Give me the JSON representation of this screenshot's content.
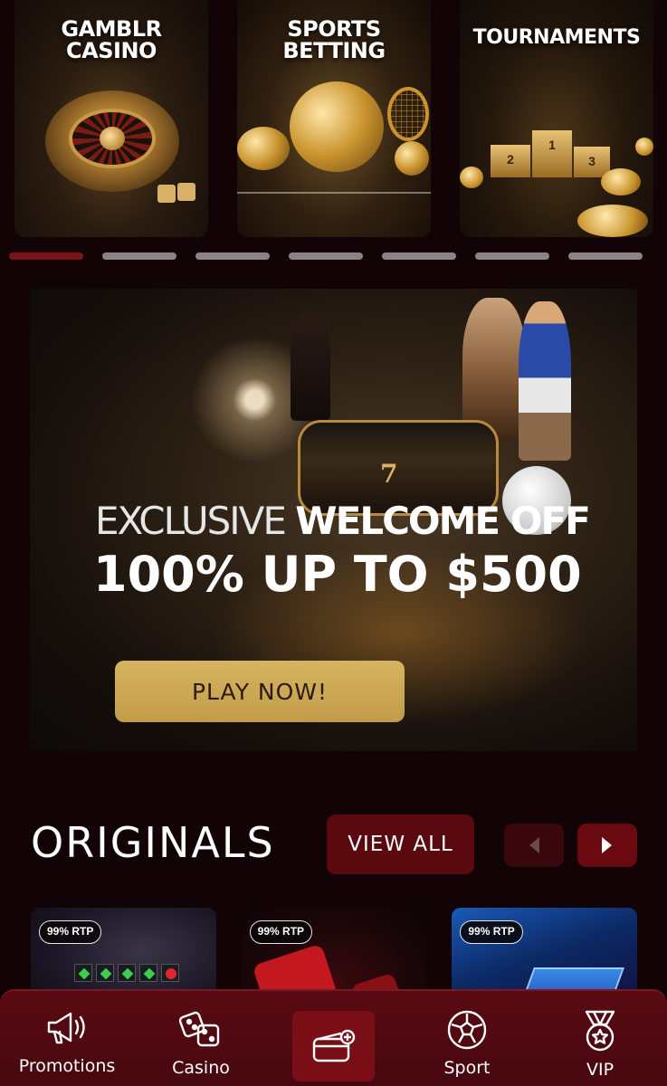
{
  "categories": [
    {
      "title": "GAMBLR\nCASINO"
    },
    {
      "title": "SPORTS\nBETTING"
    },
    {
      "title": "TOURNAMENTS"
    }
  ],
  "slider": {
    "count": 7,
    "active": 0
  },
  "hero": {
    "line1_thin": "EXCLUSIVE ",
    "line1_bold": "WELCOME OFF",
    "line2": "100% UP TO $500",
    "cta": "PLAY NOW!",
    "slot_symbols": [
      "7"
    ]
  },
  "originals": {
    "title": "ORIGINALS",
    "view_all": "VIEW ALL",
    "games": [
      {
        "badge": "99% RTP"
      },
      {
        "badge": "99% RTP"
      },
      {
        "badge": "99% RTP"
      }
    ]
  },
  "podium_numbers": [
    "2",
    "1",
    "3"
  ],
  "bottom_nav": {
    "items": [
      {
        "label": "Promotions",
        "icon": "megaphone-icon"
      },
      {
        "label": "Casino",
        "icon": "dice-icon"
      },
      {
        "label": "",
        "icon": "wallet-plus-icon"
      },
      {
        "label": "Sport",
        "icon": "soccer-ball-icon"
      },
      {
        "label": "VIP",
        "icon": "medal-star-icon"
      }
    ]
  },
  "colors": {
    "background": "#120406",
    "accent_gold": "#d6b462",
    "accent_red": "#5a0a0e",
    "nav_bg": "#4e0910"
  }
}
